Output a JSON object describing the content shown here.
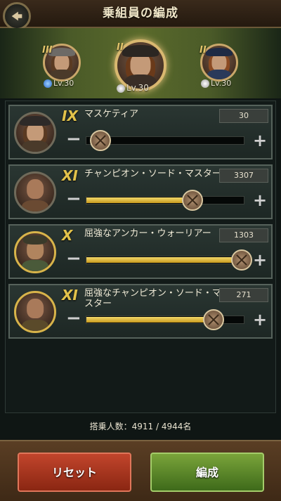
{
  "header": {
    "title": "乗組員の編成"
  },
  "crew_selector": [
    {
      "rank": "III",
      "level": "Lv.30",
      "selected": false
    },
    {
      "rank": "II",
      "level": "Lv.30",
      "selected": true
    },
    {
      "rank": "II",
      "level": "Lv.30",
      "selected": false
    }
  ],
  "rows": [
    {
      "rank": "IX",
      "name": "マスケティア",
      "count": "30",
      "fill_fraction": 0.0
    },
    {
      "rank": "XI",
      "name": "チャンピオン・ソード・マスター",
      "count": "3307",
      "fill_fraction": 0.67
    },
    {
      "rank": "X",
      "name": "屈強なアンカー・ウォーリアー",
      "count": "1303",
      "fill_fraction": 0.98
    },
    {
      "rank": "XI",
      "name": "屈強なチャンピオン・ソード・マスター",
      "count": "271",
      "fill_fraction": 0.8
    }
  ],
  "footer": {
    "crew_count": "搭乗人数：4911 / 4944名"
  },
  "buttons": {
    "reset": "リセット",
    "confirm": "編成"
  },
  "colors": {
    "accent": "#e2c24a",
    "reset": "#b03a22",
    "confirm": "#5e8a2a"
  }
}
